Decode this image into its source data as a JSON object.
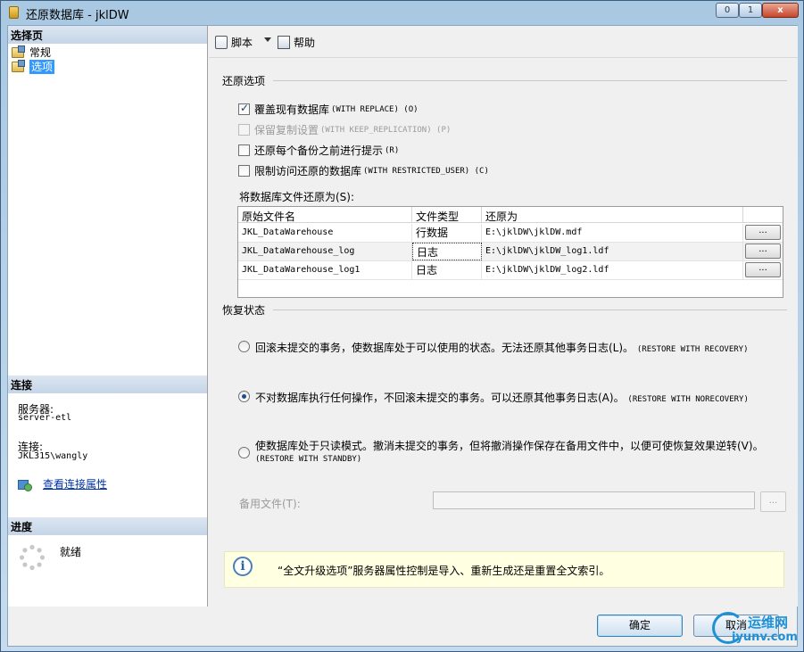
{
  "window": {
    "title": "还原数据库 - jklDW",
    "min_glyph": "0",
    "max_glyph": "1",
    "close_glyph": "x"
  },
  "left_pane": {
    "select_page_header": "选择页",
    "pages": [
      {
        "label": "常规",
        "selected": false
      },
      {
        "label": "选项",
        "selected": true
      }
    ],
    "connection_header": "连接",
    "server_label": "服务器:",
    "server_value": "server-etl",
    "login_label": "连接:",
    "login_value": "JKL315\\wangly",
    "view_connection_link": "查看连接属性",
    "progress_header": "进度",
    "progress_status": "就绪"
  },
  "toolbar": {
    "script_label": "脚本",
    "help_label": "帮助"
  },
  "restore_options": {
    "group_title": "还原选项",
    "options": [
      {
        "label": "覆盖现有数据库",
        "sub": "(WITH REPLACE) (O)",
        "checked": true,
        "enabled": true
      },
      {
        "label": "保留复制设置",
        "sub": "(WITH KEEP_REPLICATION) (P)",
        "checked": false,
        "enabled": false
      },
      {
        "label": "还原每个备份之前进行提示",
        "sub": "(R)",
        "checked": false,
        "enabled": true
      },
      {
        "label": "限制访问还原的数据库",
        "sub": "(WITH RESTRICTED_USER) (C)",
        "checked": false,
        "enabled": true
      }
    ],
    "files_label": "将数据库文件还原为(S):",
    "files_columns": [
      "原始文件名",
      "文件类型",
      "还原为",
      ""
    ],
    "files": [
      {
        "original": "JKL_DataWarehouse",
        "type": "行数据",
        "restore_as": "E:\\jklDW\\jklDW.mdf",
        "browse": "..."
      },
      {
        "original": "JKL_DataWarehouse_log",
        "type": "日志",
        "restore_as": "E:\\jklDW\\jklDW_log1.ldf",
        "browse": "..."
      },
      {
        "original": "JKL_DataWarehouse_log1",
        "type": "日志",
        "restore_as": "E:\\jklDW\\jklDW_log2.ldf",
        "browse": "..."
      }
    ]
  },
  "recovery": {
    "group_title": "恢复状态",
    "opt_recovery_text": "回滚未提交的事务，使数据库处于可以使用的状态。无法还原其他事务日志(L)。",
    "opt_recovery_sub": "(RESTORE WITH RECOVERY)",
    "opt_recovery_selected": false,
    "opt_norecovery_text": "不对数据库执行任何操作，不回滚未提交的事务。可以还原其他事务日志(A)。",
    "opt_norecovery_sub": "(RESTORE WITH NORECOVERY)",
    "opt_norecovery_selected": true,
    "opt_standby_text": "使数据库处于只读模式。撤消未提交的事务，但将撤消操作保存在备用文件中，以便可使恢复效果逆转(V)。",
    "opt_standby_sub": "(RESTORE WITH STANDBY)",
    "opt_standby_selected": false,
    "standby_label": "备用文件(T):",
    "standby_value": "",
    "standby_browse": "..."
  },
  "info": {
    "icon": "i",
    "text": "“全文升级选项”服务器属性控制是导入、重新生成还是重置全文索引。"
  },
  "buttons": {
    "ok": "确定",
    "cancel": "取消"
  },
  "watermark": {
    "cn": "运维网",
    "en": "iyunv.com"
  },
  "colors": {
    "selection": "#3399ff",
    "link": "#0033aa",
    "info_bg": "#ffffe1",
    "titlebar": "#a9c8e2"
  }
}
